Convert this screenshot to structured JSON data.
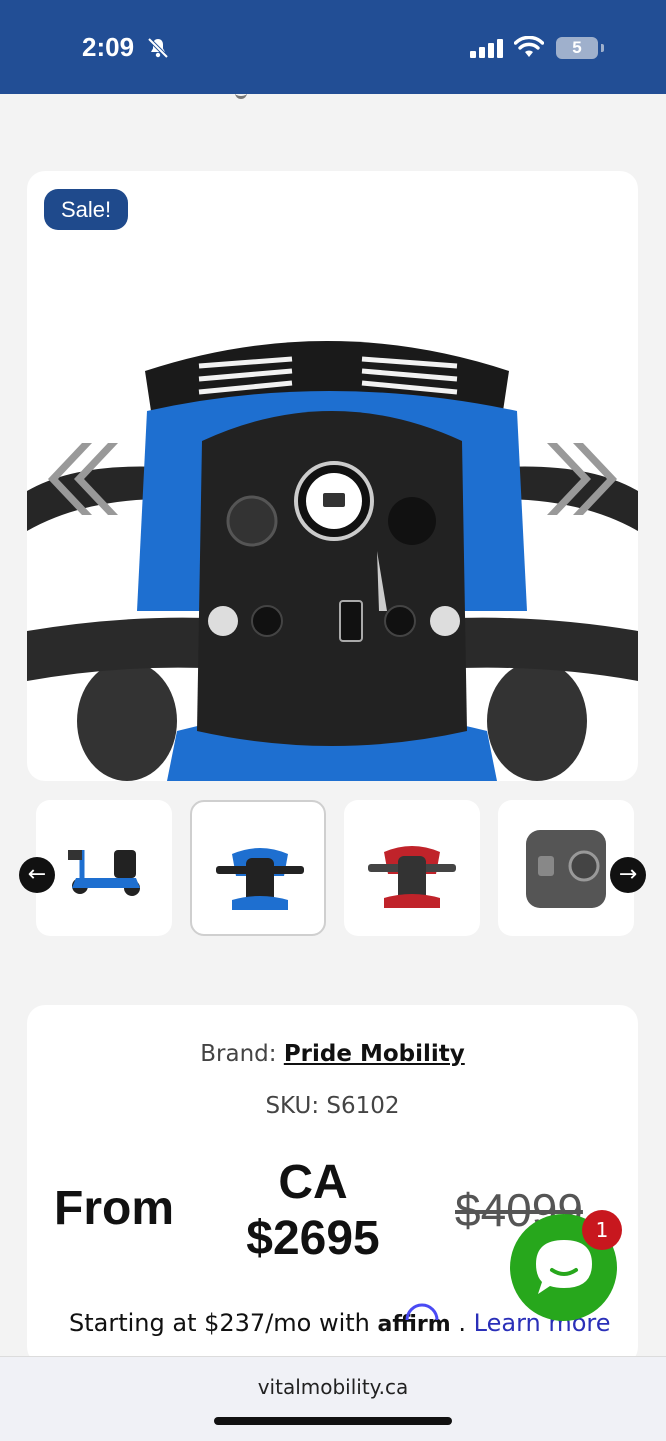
{
  "status_bar": {
    "time": "2:09",
    "battery": "5",
    "icons": [
      "bell-slash-icon",
      "signal-icon",
      "wifi-icon",
      "battery-icon"
    ]
  },
  "product": {
    "sale_badge": "Sale!",
    "brand_label": "Brand:",
    "brand_name": "Pride Mobility",
    "sku": "SKU: S6102",
    "price_from": "From",
    "price_currency": "CA",
    "price_sale": "$2695",
    "price_original": "$4099",
    "affirm_prefix": "Starting at $237/mo with",
    "affirm_logo": "affirm",
    "affirm_suffix": ".",
    "learn_more": "Learn more"
  },
  "chat": {
    "badge_count": "1"
  },
  "browser": {
    "url": "vitalmobility.ca"
  },
  "colors": {
    "header_blue": "#224e95",
    "badge_blue": "#1f4a8c",
    "chat_green": "#27a71c",
    "badge_red": "#c8171e",
    "link_blue": "#2a2fb8"
  }
}
